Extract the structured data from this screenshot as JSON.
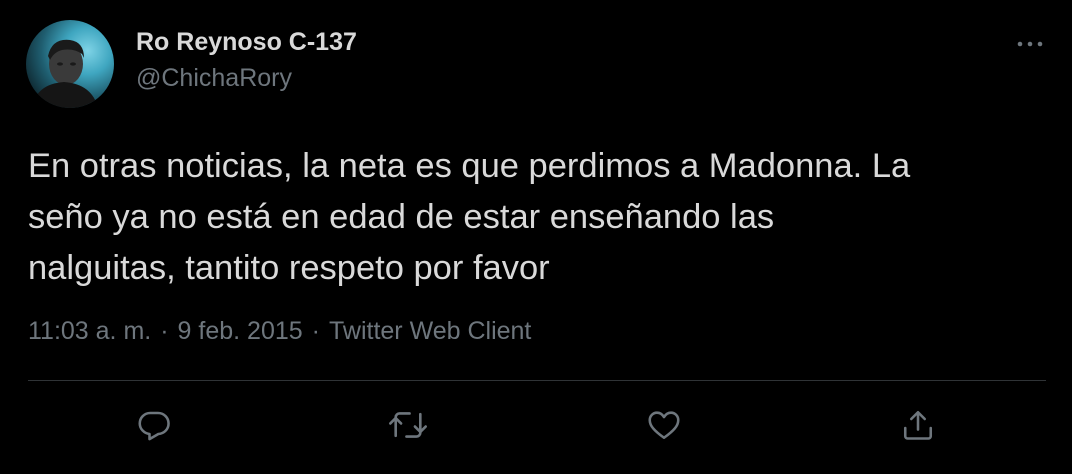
{
  "author": {
    "name": "Ro Reynoso C-137",
    "handle": "@ChichaRory"
  },
  "tweet": {
    "lines": [
      "En otras noticias, la neta es que perdimos a Madonna. La",
      "seño ya no está en edad de estar enseñando las",
      "nalguitas, tantito respeto por favor"
    ]
  },
  "meta": {
    "time": "11:03 a. m.",
    "date": "9 feb. 2015",
    "separator": "·",
    "client": "Twitter Web Client"
  },
  "actions": {
    "icons": [
      "reply-icon",
      "retweet-icon",
      "like-icon",
      "share-icon"
    ],
    "more_icon": "more-dots-icon"
  },
  "colors": {
    "background": "#000000",
    "text": "#d9d9d9",
    "secondary": "#6e767d",
    "divider": "#2f3336"
  }
}
